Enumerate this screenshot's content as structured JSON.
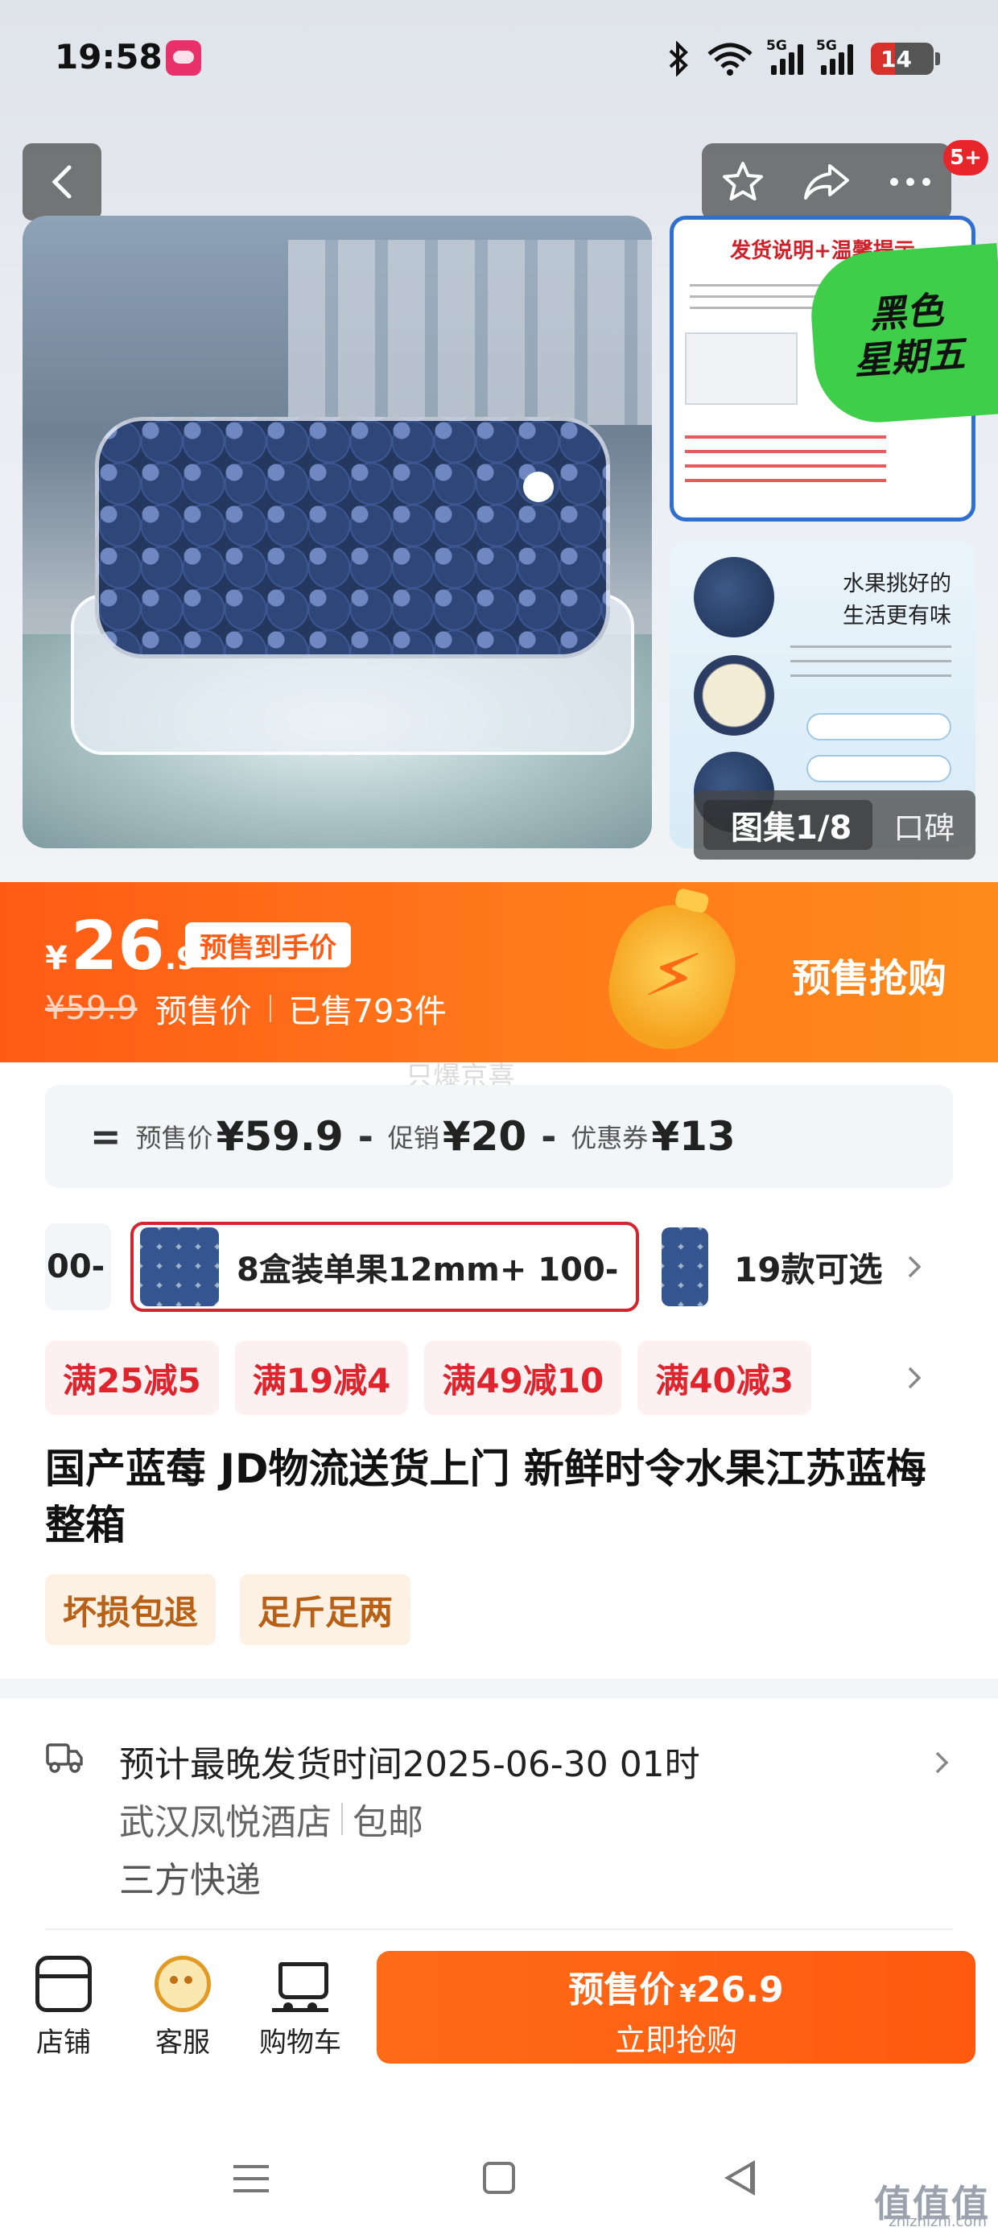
{
  "status_bar": {
    "time": "19:58",
    "signal1_label": "5G",
    "signal2_label": "5G",
    "battery": "14",
    "icons": [
      "app-icon",
      "bluetooth-icon",
      "wifi-icon",
      "signal-icon",
      "signal-icon",
      "battery-icon"
    ]
  },
  "header": {
    "back_icon": "chevron-left-icon",
    "actions": [
      "star-icon",
      "share-icon",
      "more-icon"
    ],
    "badge": "5+"
  },
  "gallery": {
    "thumb1_title": "发货说明+温馨提示",
    "promo_sticker": [
      "黑色",
      "星期五"
    ],
    "thumb2_text": [
      "水果挑好的",
      "生活更有味"
    ],
    "counter": "图集1/8",
    "tab": "口碑"
  },
  "price_banner": {
    "currency": "¥",
    "price_int": "26",
    "price_dec": ".9",
    "tag": "预售到手价",
    "original": "¥59.9",
    "presale_label": "预售价",
    "sold": "已售793件",
    "button": "预售抢购",
    "accent_color": "#ff5b15"
  },
  "watermark": "只爆京喜",
  "breakdown": {
    "eq": "=",
    "presale_label": "预售价",
    "presale_value": "¥59.9",
    "minus1": "-",
    "promo_label": "促销",
    "promo_value": "¥20",
    "minus2": "-",
    "coupon_label": "优惠券",
    "coupon_value": "¥13"
  },
  "sku": {
    "prev_fragment": "00-",
    "selected": "8盒装单果12mm+ 100-",
    "more": "19款可选"
  },
  "promotions": [
    "满25减5",
    "满19减4",
    "满49减10",
    "满40减3"
  ],
  "product_title": "国产蓝莓 JD物流送货上门 新鲜时令水果江苏蓝梅整箱",
  "services": [
    "坏损包退",
    "足斤足两"
  ],
  "shipping": {
    "line1": "预计最晚发货时间2025-06-30 01时",
    "origin": "武汉凤悦酒店",
    "free": "包邮",
    "carrier": "三方快递"
  },
  "bottom_bar": {
    "shop": "店铺",
    "service": "客服",
    "cart": "购物车",
    "buy_label": "预售价",
    "buy_currency": "¥",
    "buy_price": "26.9",
    "buy_sub": "立即抢购"
  },
  "site_watermark": "值值值",
  "site_url": "zhizhizhi.com"
}
